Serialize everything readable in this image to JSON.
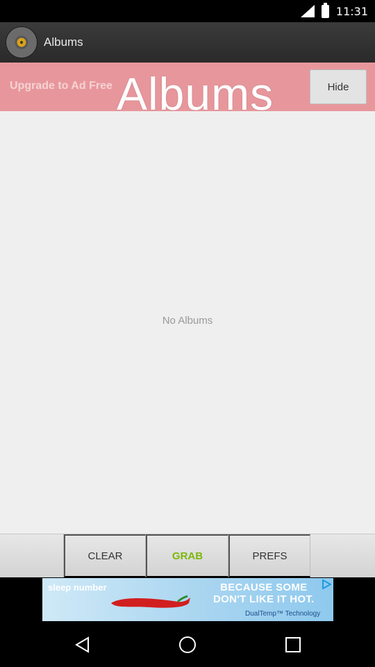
{
  "status_bar": {
    "time": "11:31"
  },
  "action_bar": {
    "title": "Albums",
    "icon": "vinyl-record-icon"
  },
  "upgrade_banner": {
    "label": "Upgrade to Ad Free",
    "overlay_title": "Albums",
    "hide_label": "Hide"
  },
  "content": {
    "empty_message": "No Albums"
  },
  "toolbar": {
    "clear_label": "CLEAR",
    "grab_label": "GRAB",
    "prefs_label": "PREFS"
  },
  "ad": {
    "brand": "sleep number",
    "headline_line1": "BECAUSE SOME",
    "headline_line2": "DON'T LIKE IT HOT.",
    "sub": "DualTemp™ Technology"
  },
  "nav": {
    "back": "back-icon",
    "home": "home-icon",
    "recents": "recents-icon"
  },
  "colors": {
    "banner": "#e7979c",
    "grab": "#7db70c",
    "actionbar": "#2f2f2f"
  }
}
